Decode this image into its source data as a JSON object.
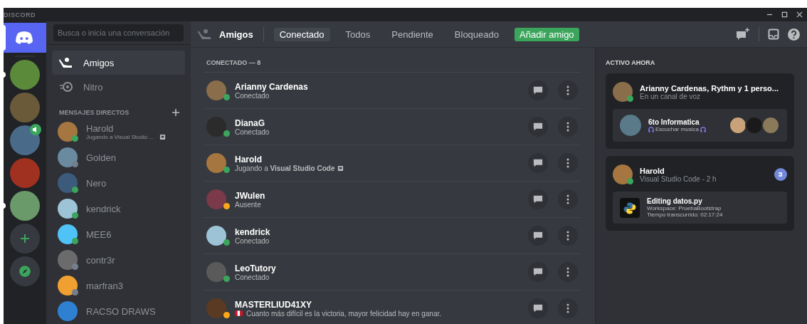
{
  "app_title": "DISCORD",
  "servers": [
    {
      "kind": "home",
      "selected": true,
      "unread": false,
      "voice": false
    },
    {
      "kind": "server",
      "selected": false,
      "unread": true,
      "voice": false
    },
    {
      "kind": "server",
      "selected": false,
      "unread": false,
      "voice": false
    },
    {
      "kind": "server",
      "selected": false,
      "unread": false,
      "voice": true
    },
    {
      "kind": "server",
      "selected": false,
      "unread": false,
      "voice": false
    },
    {
      "kind": "server",
      "selected": false,
      "unread": true,
      "voice": false
    },
    {
      "kind": "add",
      "selected": false,
      "unread": false,
      "voice": false
    },
    {
      "kind": "explore",
      "selected": false,
      "unread": false,
      "voice": false
    }
  ],
  "search": {
    "placeholder": "Busca o inicia una conversación"
  },
  "nav": [
    {
      "kind": "friends",
      "label": "Amigos",
      "selected": true
    },
    {
      "kind": "nitro",
      "label": "Nitro",
      "selected": false
    }
  ],
  "dm_heading": "MENSAJES DIRECTOS",
  "dms": [
    {
      "name": "Harold",
      "activity": "Jugando a Visual Studio ...",
      "color": "#3ba55c",
      "game_badge": true
    },
    {
      "name": "Golden",
      "color": "#747f8d",
      "game_badge": false
    },
    {
      "name": "Nero",
      "color": "#3ba55c",
      "game_badge": false
    },
    {
      "name": "kendrick",
      "color": "#3ba55c",
      "game_badge": false
    },
    {
      "name": "MEE6",
      "color": "#3ba55c",
      "game_badge": false
    },
    {
      "name": "contr3r",
      "color": "#747f8d",
      "game_badge": false
    },
    {
      "name": "marfran3",
      "color": "#747f8d",
      "game_badge": false
    },
    {
      "name": "RACSO DRAWS",
      "game_badge": false
    }
  ],
  "header": {
    "title": "Amigos",
    "tabs": [
      {
        "label": "Conectado",
        "selected": true
      },
      {
        "label": "Todos",
        "selected": false
      },
      {
        "label": "Pendiente",
        "selected": false
      },
      {
        "label": "Bloqueado",
        "selected": false
      }
    ],
    "add_friend": "Añadir amigo"
  },
  "list_heading": "CONECTADO — 8",
  "friends": [
    {
      "name": "Arianny Cardenas",
      "status_text": "Conectado",
      "color": "#3ba55c",
      "game_badge": false,
      "flag": false
    },
    {
      "name": "DianaG",
      "status_text": "Conectado",
      "color": "#3ba55c",
      "game_badge": false,
      "flag": false
    },
    {
      "name": "Harold",
      "status_text": "Jugando a **Visual Studio Code**",
      "color": "#3ba55c",
      "game_badge": true,
      "flag": false
    },
    {
      "name": "JWulen",
      "status_text": "Ausente",
      "color": "#faa81a",
      "game_badge": false,
      "flag": false
    },
    {
      "name": "kendrick",
      "status_text": "Conectado",
      "color": "#3ba55c",
      "game_badge": false,
      "flag": false
    },
    {
      "name": "LeoTutory",
      "status_text": "Conectado",
      "color": "#3ba55c",
      "game_badge": false,
      "flag": false
    },
    {
      "name": "MASTERLIUD41XY",
      "status_text": "Cuanto más difícil es la victoria, mayor felicidad hay en ganar.",
      "color": "#faa81a",
      "game_badge": false,
      "flag": true
    }
  ],
  "active_now": {
    "heading": "ACTIVO AHORA",
    "cards": [
      {
        "kind": "voice",
        "title": "Arianny Cardenas, Rythm y 1 perso...",
        "subtitle": "En un canal de voz",
        "color": "#3ba55c",
        "detail": {
          "title": "6to Informatica",
          "lines": [
            "Escuchar musica"
          ]
        }
      },
      {
        "kind": "game",
        "title": "Harold",
        "subtitle": "Visual Studio Code - 2 h",
        "color": "#3ba55c",
        "detail": {
          "title": "Editing datos.py",
          "lines": [
            "Workspace: PruebaBootstrap",
            "Tiempo transcurrido: 02:17:24"
          ]
        }
      }
    ]
  }
}
